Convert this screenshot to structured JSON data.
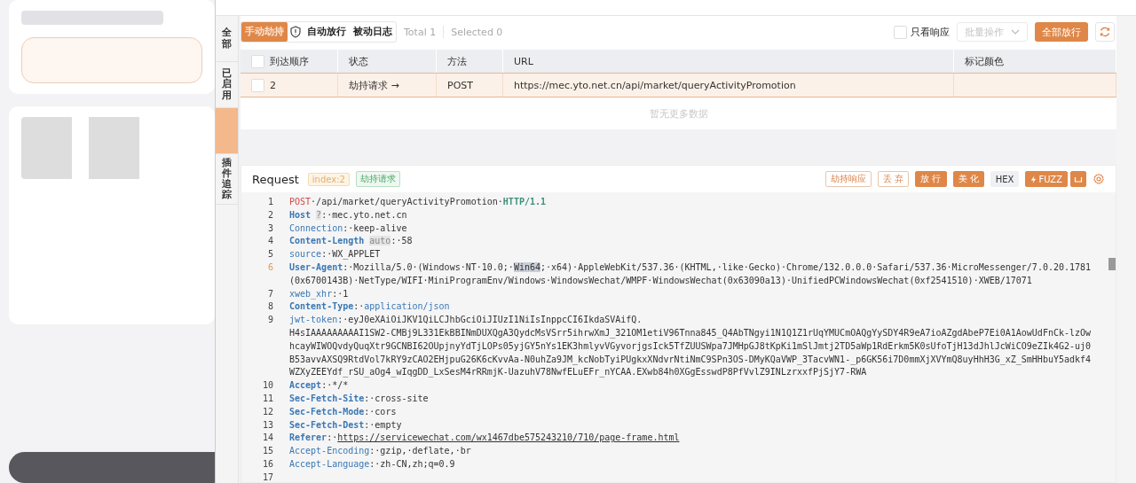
{
  "side_tabs": [
    {
      "label": "全部",
      "selected": false
    },
    {
      "label": "已启用",
      "selected": false
    },
    {
      "selected": true
    },
    {
      "label": "插件追踪",
      "selected": false
    }
  ],
  "toolbar": {
    "modes": [
      {
        "label": "手动劫持",
        "selected": true
      },
      {
        "label": "自动放行",
        "selected": false
      },
      {
        "label": "被动日志",
        "selected": false
      }
    ],
    "total": "Total 1",
    "selected_count": "Selected 0",
    "only_response": {
      "label": "只看响应",
      "checked": false
    },
    "batch_select": {
      "placeholder": "批量操作",
      "disabled": true
    },
    "release_all": "全部放行"
  },
  "table": {
    "all_checked": false,
    "columns": [
      "到达顺序",
      "状态",
      "方法",
      "URL",
      "标记颜色"
    ],
    "rows": [
      {
        "order": "2",
        "status": "劫持请求 →",
        "method": "POST",
        "url": "https://mec.yto.net.cn/api/market/queryActivityPromotion",
        "mark_color": "",
        "checked": false,
        "selected": true
      }
    ],
    "empty_note": "暂无更多数据"
  },
  "request": {
    "title": "Request",
    "index_badge": "index:2",
    "status_badge": "劫持请求",
    "buttons": [
      {
        "label": "劫持响应",
        "kind": "outline"
      },
      {
        "label": "丢 弃",
        "kind": "outline"
      },
      {
        "label": "放 行",
        "kind": "filled"
      },
      {
        "label": "美 化",
        "kind": "filled"
      },
      {
        "label": "HEX",
        "kind": "plain"
      },
      {
        "label": "FUZZ",
        "kind": "fuzz"
      }
    ],
    "lines": [
      {
        "num": "1",
        "active": false,
        "parts": [
          {
            "kind": "method",
            "text": "POST"
          },
          {
            "kind": "plain",
            "text": "·/api/market/queryActivityPromotion·"
          },
          {
            "kind": "proto",
            "text": "HTTP/1.1"
          }
        ]
      },
      {
        "num": "2",
        "active": false,
        "parts": [
          {
            "kind": "keybold",
            "text": "Host"
          },
          {
            "kind": "hint",
            "text": "?"
          },
          {
            "kind": "plain",
            "text": ":·mec.yto.net.cn"
          }
        ]
      },
      {
        "num": "3",
        "active": false,
        "parts": [
          {
            "kind": "key",
            "text": "Connection"
          },
          {
            "kind": "plain",
            "text": ":·keep-alive"
          }
        ]
      },
      {
        "num": "4",
        "active": false,
        "parts": [
          {
            "kind": "keybold",
            "text": "Content-Length"
          },
          {
            "kind": "hint",
            "text": "auto"
          },
          {
            "kind": "plain",
            "text": ":·58"
          }
        ]
      },
      {
        "num": "5",
        "active": false,
        "parts": [
          {
            "kind": "key",
            "text": "source"
          },
          {
            "kind": "plain",
            "text": ":·WX_APPLET"
          }
        ]
      },
      {
        "num": "6",
        "active": true,
        "parts": [
          {
            "kind": "keybold",
            "text": "User-Agent"
          },
          {
            "kind": "plain",
            "text": ":·Mozilla/5.0·(Windows·NT·10.0;·"
          },
          {
            "kind": "selection",
            "text": "Win64"
          },
          {
            "kind": "plain",
            "text": ";·x64)·AppleWebKit/537.36·(KHTML,·like·Gecko)·Chrome/132.0.0.0·Safari/537.36·MicroMessenger/7.0.20.1781"
          }
        ],
        "continued": [
          "(0x6700143B)·NetType/WIFI·MiniProgramEnv/Windows·WindowsWechat/WMPF·WindowsWechat(0x63090a13)·UnifiedPCWindowsWechat(0xf2541510)·XWEB/17071"
        ]
      },
      {
        "num": "7",
        "active": false,
        "parts": [
          {
            "kind": "key",
            "text": "xweb_xhr"
          },
          {
            "kind": "plain",
            "text": ":·1"
          }
        ]
      },
      {
        "num": "8",
        "active": false,
        "parts": [
          {
            "kind": "keybold",
            "text": "Content-Type"
          },
          {
            "kind": "plain",
            "text": ":·"
          },
          {
            "kind": "value",
            "text": "application/json"
          }
        ]
      },
      {
        "num": "9",
        "active": false,
        "parts": [
          {
            "kind": "key",
            "text": "jwt-token"
          },
          {
            "kind": "plain",
            "text": ":·eyJ0eXAiOiJKV1QiLCJhbGciOiJIUzI1NiIsInppcCI6IkdaSVAifQ."
          }
        ],
        "continued": [
          "H4sIAAAAAAAAAI1SW2-CMBj9L331EkBBINmDUXQgA3QydcMsVSrr5ihrwXmJ_321OM1etiV96Tnna845_Q4AbTNgyi1N1Q1Z1rUqYMUCmOAQgYySDY4R9eA7ioAZgdAbeP7Ei0A1AowUdFnCk-lzOw",
          "hcayWIWOQvdyQuqXtr9GCNBI62OUpjnyYdTjLOPs05yjGY5nYs1EK3hmlyvVGyvorjgsIck5TfZUUSWpa7JMHpGJ8tKpKi1mSlJmtj2TD5aWp1RdErkm5K0sUfoTjH13dJhlJcWiCO9eZIk4G2-uj0",
          "B53avvAXSQ9RtdVol7kRY9zCAO2EHjpuG26K6cKvvAa-N0uhZa9JM_kcNobTyiPUgkxXNdvrNtiNmC9SPn3OS-DMyKQaVWP_3TacvWN1-_p6GK56i7D0mmXjXVYmQ8uyHhH3G_xZ_SmHHbuY5adkf4",
          "WZXyZEEYdf_rSU_aOg4_wIqgDD_LxSesM4rRRmjK-UazuhV78NwfELuEFr_nYCAA.EXwb84h0XGgEsswdP8PfVvlZ9INLzrxxfPjSjY7-RWA"
        ]
      },
      {
        "num": "10",
        "active": false,
        "parts": [
          {
            "kind": "keybold",
            "text": "Accept"
          },
          {
            "kind": "plain",
            "text": ":·*/*"
          }
        ]
      },
      {
        "num": "11",
        "active": false,
        "parts": [
          {
            "kind": "keybold",
            "text": "Sec-Fetch-Site"
          },
          {
            "kind": "plain",
            "text": ":·cross-site"
          }
        ]
      },
      {
        "num": "12",
        "active": false,
        "parts": [
          {
            "kind": "keybold",
            "text": "Sec-Fetch-Mode"
          },
          {
            "kind": "plain",
            "text": ":·cors"
          }
        ]
      },
      {
        "num": "13",
        "active": false,
        "parts": [
          {
            "kind": "keybold",
            "text": "Sec-Fetch-Dest"
          },
          {
            "kind": "plain",
            "text": ":·empty"
          }
        ]
      },
      {
        "num": "14",
        "active": false,
        "parts": [
          {
            "kind": "keybold",
            "text": "Referer"
          },
          {
            "kind": "plain",
            "text": ":·"
          },
          {
            "kind": "link",
            "text": "https://servicewechat.com/wx1467dbe575243210/710/page-frame.html"
          }
        ]
      },
      {
        "num": "15",
        "active": false,
        "parts": [
          {
            "kind": "key",
            "text": "Accept-Encoding"
          },
          {
            "kind": "plain",
            "text": ":·gzip,·deflate,·br"
          }
        ]
      },
      {
        "num": "16",
        "active": false,
        "parts": [
          {
            "kind": "key",
            "text": "Accept-Language"
          },
          {
            "kind": "plain",
            "text": ":·zh-CN,zh;q=0.9"
          }
        ]
      },
      {
        "num": "17",
        "active": false
      }
    ]
  }
}
